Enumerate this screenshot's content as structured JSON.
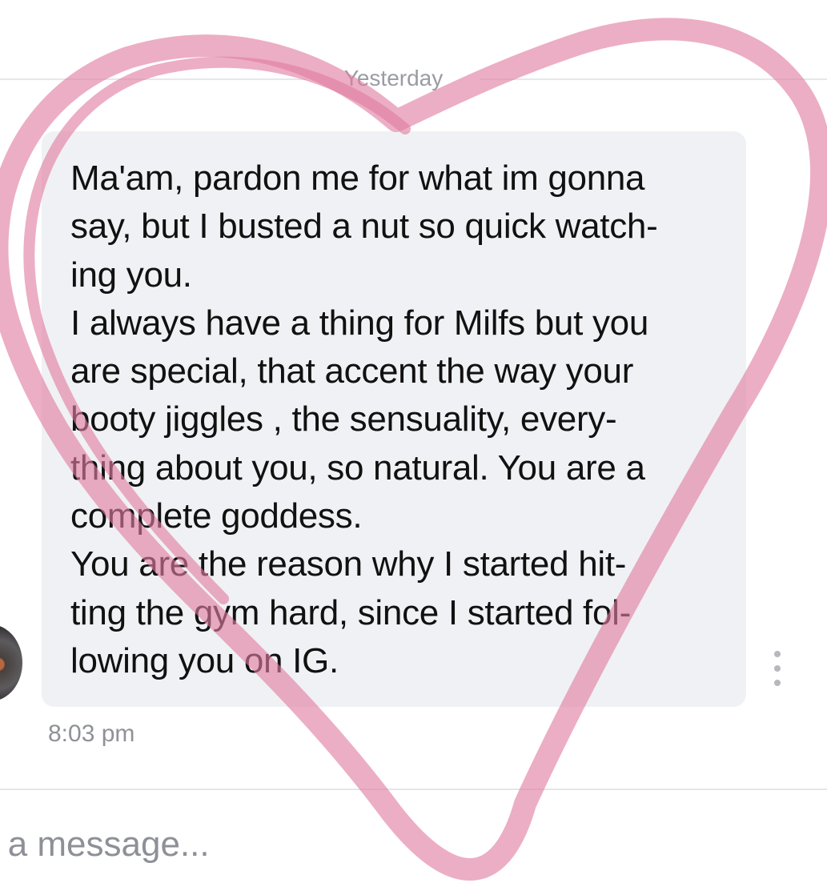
{
  "conversation": {
    "date_label": "Yesterday",
    "message_lines": [
      "Ma'am, pardon me for what im gonna",
      "say, but I busted a nut so quick watch-",
      "ing you.",
      "I always have a thing for Milfs but you",
      "are special, that accent the way your",
      "booty jiggles , the sensuality, every-",
      "thing about you, so natural. You are a",
      "complete goddess.",
      "You are the reason why I started hit-",
      "ting the gym hard, since I started fol-",
      "lowing you on IG."
    ],
    "timestamp": "8:03 pm"
  },
  "composer": {
    "placeholder": "e a message..."
  },
  "colors": {
    "bubble": "#f0f1f4",
    "heart_stroke": "#e07da0"
  },
  "icons": {
    "message_actions": "more-vertical-icon",
    "overlay": "heart-outline-icon"
  }
}
